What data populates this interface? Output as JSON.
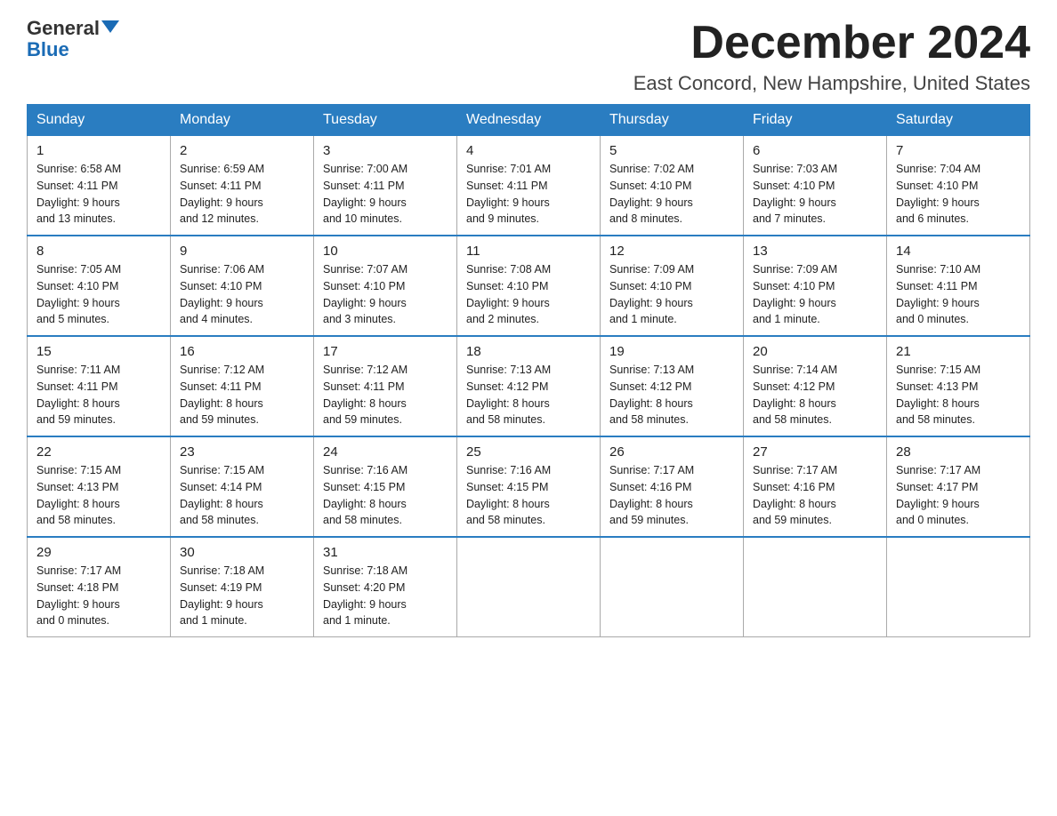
{
  "logo": {
    "general": "General",
    "blue": "Blue"
  },
  "title": "December 2024",
  "location": "East Concord, New Hampshire, United States",
  "days_of_week": [
    "Sunday",
    "Monday",
    "Tuesday",
    "Wednesday",
    "Thursday",
    "Friday",
    "Saturday"
  ],
  "weeks": [
    [
      {
        "day": "1",
        "sunrise": "6:58 AM",
        "sunset": "4:11 PM",
        "daylight": "9 hours and 13 minutes."
      },
      {
        "day": "2",
        "sunrise": "6:59 AM",
        "sunset": "4:11 PM",
        "daylight": "9 hours and 12 minutes."
      },
      {
        "day": "3",
        "sunrise": "7:00 AM",
        "sunset": "4:11 PM",
        "daylight": "9 hours and 10 minutes."
      },
      {
        "day": "4",
        "sunrise": "7:01 AM",
        "sunset": "4:11 PM",
        "daylight": "9 hours and 9 minutes."
      },
      {
        "day": "5",
        "sunrise": "7:02 AM",
        "sunset": "4:10 PM",
        "daylight": "9 hours and 8 minutes."
      },
      {
        "day": "6",
        "sunrise": "7:03 AM",
        "sunset": "4:10 PM",
        "daylight": "9 hours and 7 minutes."
      },
      {
        "day": "7",
        "sunrise": "7:04 AM",
        "sunset": "4:10 PM",
        "daylight": "9 hours and 6 minutes."
      }
    ],
    [
      {
        "day": "8",
        "sunrise": "7:05 AM",
        "sunset": "4:10 PM",
        "daylight": "9 hours and 5 minutes."
      },
      {
        "day": "9",
        "sunrise": "7:06 AM",
        "sunset": "4:10 PM",
        "daylight": "9 hours and 4 minutes."
      },
      {
        "day": "10",
        "sunrise": "7:07 AM",
        "sunset": "4:10 PM",
        "daylight": "9 hours and 3 minutes."
      },
      {
        "day": "11",
        "sunrise": "7:08 AM",
        "sunset": "4:10 PM",
        "daylight": "9 hours and 2 minutes."
      },
      {
        "day": "12",
        "sunrise": "7:09 AM",
        "sunset": "4:10 PM",
        "daylight": "9 hours and 1 minute."
      },
      {
        "day": "13",
        "sunrise": "7:09 AM",
        "sunset": "4:10 PM",
        "daylight": "9 hours and 1 minute."
      },
      {
        "day": "14",
        "sunrise": "7:10 AM",
        "sunset": "4:11 PM",
        "daylight": "9 hours and 0 minutes."
      }
    ],
    [
      {
        "day": "15",
        "sunrise": "7:11 AM",
        "sunset": "4:11 PM",
        "daylight": "8 hours and 59 minutes."
      },
      {
        "day": "16",
        "sunrise": "7:12 AM",
        "sunset": "4:11 PM",
        "daylight": "8 hours and 59 minutes."
      },
      {
        "day": "17",
        "sunrise": "7:12 AM",
        "sunset": "4:11 PM",
        "daylight": "8 hours and 59 minutes."
      },
      {
        "day": "18",
        "sunrise": "7:13 AM",
        "sunset": "4:12 PM",
        "daylight": "8 hours and 58 minutes."
      },
      {
        "day": "19",
        "sunrise": "7:13 AM",
        "sunset": "4:12 PM",
        "daylight": "8 hours and 58 minutes."
      },
      {
        "day": "20",
        "sunrise": "7:14 AM",
        "sunset": "4:12 PM",
        "daylight": "8 hours and 58 minutes."
      },
      {
        "day": "21",
        "sunrise": "7:15 AM",
        "sunset": "4:13 PM",
        "daylight": "8 hours and 58 minutes."
      }
    ],
    [
      {
        "day": "22",
        "sunrise": "7:15 AM",
        "sunset": "4:13 PM",
        "daylight": "8 hours and 58 minutes."
      },
      {
        "day": "23",
        "sunrise": "7:15 AM",
        "sunset": "4:14 PM",
        "daylight": "8 hours and 58 minutes."
      },
      {
        "day": "24",
        "sunrise": "7:16 AM",
        "sunset": "4:15 PM",
        "daylight": "8 hours and 58 minutes."
      },
      {
        "day": "25",
        "sunrise": "7:16 AM",
        "sunset": "4:15 PM",
        "daylight": "8 hours and 58 minutes."
      },
      {
        "day": "26",
        "sunrise": "7:17 AM",
        "sunset": "4:16 PM",
        "daylight": "8 hours and 59 minutes."
      },
      {
        "day": "27",
        "sunrise": "7:17 AM",
        "sunset": "4:16 PM",
        "daylight": "8 hours and 59 minutes."
      },
      {
        "day": "28",
        "sunrise": "7:17 AM",
        "sunset": "4:17 PM",
        "daylight": "9 hours and 0 minutes."
      }
    ],
    [
      {
        "day": "29",
        "sunrise": "7:17 AM",
        "sunset": "4:18 PM",
        "daylight": "9 hours and 0 minutes."
      },
      {
        "day": "30",
        "sunrise": "7:18 AM",
        "sunset": "4:19 PM",
        "daylight": "9 hours and 1 minute."
      },
      {
        "day": "31",
        "sunrise": "7:18 AM",
        "sunset": "4:20 PM",
        "daylight": "9 hours and 1 minute."
      },
      null,
      null,
      null,
      null
    ]
  ],
  "labels": {
    "sunrise": "Sunrise:",
    "sunset": "Sunset:",
    "daylight": "Daylight:"
  }
}
